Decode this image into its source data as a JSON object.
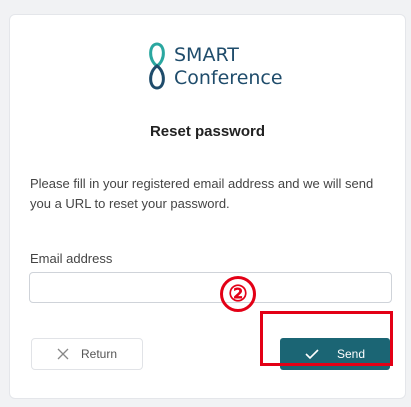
{
  "brand": {
    "line1": "SMART",
    "line2": "Conference",
    "logo_icon": "infinity-knot-icon",
    "colors": {
      "logo_blue": "#1f4c6b",
      "logo_green": "#2aa7a0"
    }
  },
  "page": {
    "title": "Reset password",
    "description": "Please fill in your registered email address and we will send you a URL to reset your password."
  },
  "form": {
    "email_label": "Email address",
    "email_value": "",
    "email_placeholder": ""
  },
  "actions": {
    "return_label": "Return",
    "return_icon": "close-icon",
    "send_label": "Send",
    "send_icon": "check-icon",
    "send_color": "#1b6574"
  },
  "annotation": {
    "step_marker": "②",
    "highlight_color": "#e30016"
  }
}
